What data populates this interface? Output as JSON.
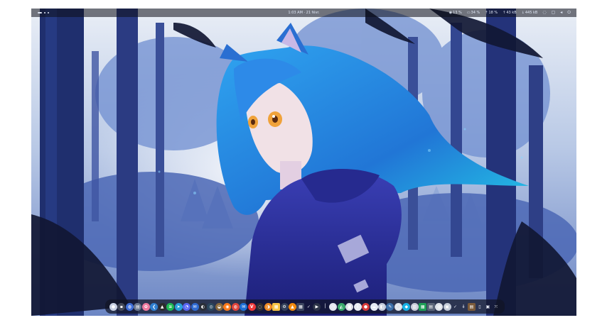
{
  "topbar": {
    "clock": "1:03 AM · 21 févr.",
    "stats": [
      {
        "icon_name": "cpu-icon",
        "glyph": "◉",
        "value": "13 %"
      },
      {
        "icon_name": "memory-icon",
        "glyph": "▭",
        "value": "34 %"
      },
      {
        "icon_name": "thermometer-icon",
        "glyph": "⇡",
        "value": "18 %"
      },
      {
        "icon_name": "upload-icon",
        "glyph": "↑",
        "value": "43 kB"
      },
      {
        "icon_name": "download-icon",
        "glyph": "↓",
        "value": "445 kB"
      }
    ],
    "system_icons": [
      {
        "name": "network-icon",
        "glyph": "◌"
      },
      {
        "name": "display-icon",
        "glyph": "▢"
      },
      {
        "name": "volume-icon",
        "glyph": "◂"
      },
      {
        "name": "power-icon",
        "glyph": "⏻"
      }
    ]
  },
  "dock": {
    "apps": [
      {
        "name": "launcher-icon",
        "color": "#c9d1e3",
        "glyph": "●"
      },
      {
        "name": "terminal-icon",
        "color": "#444a5a",
        "glyph": "▪"
      },
      {
        "name": "browser-icon",
        "color": "#3f6fd8",
        "glyph": "◍"
      },
      {
        "name": "files-icon",
        "color": "#6d7a92",
        "glyph": "▤"
      },
      {
        "name": "photos-icon",
        "color": "#ee7aa0",
        "glyph": "✿"
      },
      {
        "name": "code-editor-icon",
        "color": "#2f7fd0",
        "glyph": "❮"
      },
      {
        "name": "inkscape-icon",
        "color": "#2c2c2c",
        "glyph": "▲"
      },
      {
        "name": "spotify-icon",
        "color": "#1db954",
        "glyph": "≋"
      },
      {
        "name": "telegram-icon",
        "color": "#2aa1da",
        "glyph": "➤"
      },
      {
        "name": "discord-icon",
        "color": "#5865f2",
        "glyph": "◔"
      },
      {
        "name": "mail-icon",
        "color": "#2f6ad0",
        "glyph": "✉"
      },
      {
        "name": "github-icon",
        "color": "#2b2f38",
        "glyph": "◐"
      },
      {
        "name": "steam-icon",
        "color": "#2a475e",
        "glyph": "◎"
      },
      {
        "name": "gimp-icon",
        "color": "#8a6a3d",
        "glyph": "◒"
      },
      {
        "name": "firefox-icon",
        "color": "#ff7a1a",
        "glyph": "◉"
      },
      {
        "name": "chrome-icon",
        "color": "#e0443b",
        "glyph": "◍"
      },
      {
        "name": "thunderbird-icon",
        "color": "#1f6fd6",
        "glyph": "✉"
      },
      {
        "name": "vivaldi-icon",
        "color": "#ef3939",
        "glyph": "V"
      },
      {
        "name": "obs-icon",
        "color": "#302e31",
        "glyph": "◌"
      },
      {
        "name": "blender-icon",
        "color": "#f08a24",
        "glyph": "◑"
      },
      {
        "name": "notes-icon",
        "color": "#f6c445",
        "glyph": "▦"
      },
      {
        "name": "settings-icon",
        "color": "#33405a",
        "glyph": "⚙"
      },
      {
        "name": "vlc-icon",
        "color": "#f28a0e",
        "glyph": "▲"
      },
      {
        "name": "calculator-icon",
        "color": "#3c4660",
        "glyph": "▦"
      },
      {
        "name": "checkmark-icon",
        "color": "transparent",
        "glyph": "✓"
      },
      {
        "name": "kdenlive-icon",
        "color": "#2c3448",
        "glyph": "▶"
      },
      {
        "name": "pipe-icon",
        "color": "transparent",
        "glyph": "⏐"
      },
      {
        "name": "clock-icon",
        "color": "#e2e6ef",
        "glyph": "◷"
      },
      {
        "name": "maps-icon",
        "color": "#3aa96b",
        "glyph": "◭"
      },
      {
        "name": "camera-icon",
        "color": "#dcdfe7",
        "glyph": "◙"
      },
      {
        "name": "info-icon",
        "color": "#e9edf4",
        "glyph": "i"
      },
      {
        "name": "record-icon",
        "color": "#d63a3a",
        "glyph": "●"
      },
      {
        "name": "weather-icon",
        "color": "#e6ecf4",
        "glyph": "☁"
      },
      {
        "name": "tweaks-icon",
        "color": "#c4ccdb",
        "glyph": "◧"
      },
      {
        "name": "krita-icon",
        "color": "#3b6ea8",
        "glyph": "✎"
      },
      {
        "name": "chat-icon",
        "color": "#dfe3ea",
        "glyph": "◯"
      },
      {
        "name": "kodi-icon",
        "color": "#17b2e6",
        "glyph": "◆"
      },
      {
        "name": "trash-icon",
        "color": "#c9ced9",
        "glyph": "▥"
      },
      {
        "name": "spreadsheet-icon",
        "color": "#1e9e57",
        "glyph": "▦"
      },
      {
        "name": "reader-icon",
        "color": "#5a6478",
        "glyph": "▤"
      },
      {
        "name": "store-icon",
        "color": "#dfe3ea",
        "glyph": "◍"
      },
      {
        "name": "monitor-icon",
        "color": "#c2cad8",
        "glyph": "▣"
      },
      {
        "name": "check-icon",
        "color": "transparent",
        "glyph": "✓"
      },
      {
        "name": "torch-icon",
        "color": "transparent",
        "glyph": "⸸"
      },
      {
        "name": "archive-icon",
        "color": "#7a5a3a",
        "glyph": "▤"
      },
      {
        "name": "window-icon",
        "color": "transparent",
        "glyph": "▯"
      },
      {
        "name": "screenshot-icon",
        "color": "transparent",
        "glyph": "▣"
      },
      {
        "name": "show-apps-icon",
        "color": "transparent",
        "glyph": "⁙"
      }
    ]
  }
}
